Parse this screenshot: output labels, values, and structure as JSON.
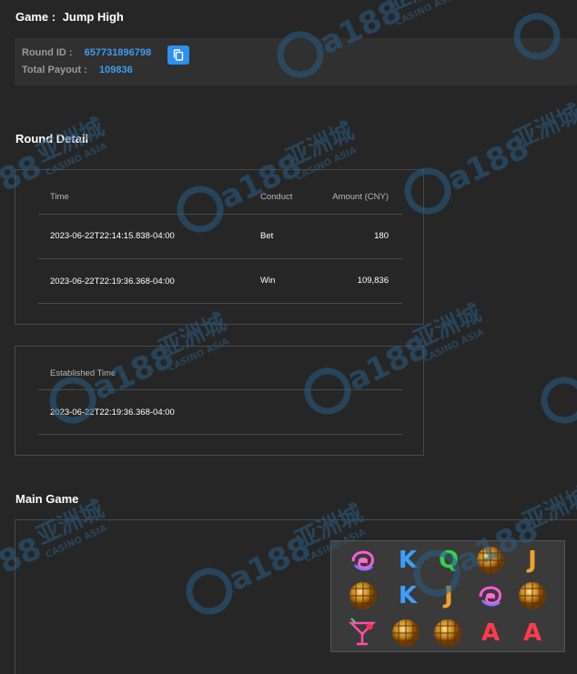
{
  "header": {
    "game_label": "Game :",
    "game_name": "Jump High"
  },
  "info": {
    "round_id_label": "Round ID :",
    "round_id": "657731896798",
    "total_payout_label": "Total Payout :",
    "total_payout": "109836",
    "copy_icon": "copy-icon"
  },
  "round_detail": {
    "title": "Round Detail",
    "columns": [
      "Time",
      "Conduct",
      "Amount (CNY)"
    ],
    "rows": [
      {
        "time": "2023-06-22T22:14:15.838-04:00",
        "conduct": "Bet",
        "amount": "180"
      },
      {
        "time": "2023-06-22T22:19:36.368-04:00",
        "conduct": "Win",
        "amount": "109,836"
      }
    ]
  },
  "established": {
    "label": "Established Time",
    "value": "2023-06-22T22:19:36.368-04:00"
  },
  "main_game": {
    "title": "Main Game",
    "grid": [
      [
        "lips",
        "K",
        "Q",
        "disco-ball",
        "J"
      ],
      [
        "disco-ball",
        "K",
        "J",
        "lips",
        "disco-ball"
      ],
      [
        "cocktail",
        "disco-ball",
        "disco-ball",
        "A",
        "A"
      ]
    ],
    "letter_colors": {
      "K": "#3aa0ff",
      "Q": "#35d04a",
      "J": "#f0a030",
      "A": "#ff3b4e"
    }
  },
  "watermark": {
    "brand": "CQ188",
    "cn": "亚洲城",
    "sub": "CASINO ASIA"
  },
  "colors": {
    "background": "#262626",
    "accent": "#3d9cf0",
    "border": "#4a4a4a"
  }
}
